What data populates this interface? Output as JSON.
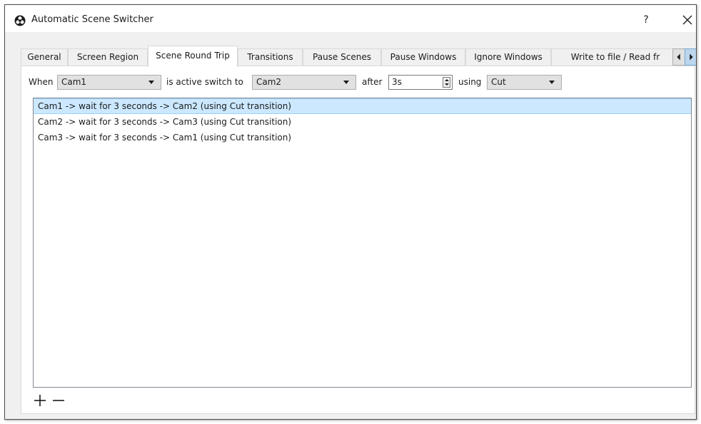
{
  "window": {
    "title": "Automatic Scene Switcher",
    "help_label": "?",
    "close_icon": "close-icon",
    "app_icon": "obs-logo-icon"
  },
  "tabs": [
    {
      "label": "General",
      "active": false
    },
    {
      "label": "Screen Region",
      "active": false
    },
    {
      "label": "Scene Round Trip",
      "active": true
    },
    {
      "label": "Transitions",
      "active": false
    },
    {
      "label": "Pause Scenes",
      "active": false
    },
    {
      "label": "Pause Windows",
      "active": false
    },
    {
      "label": "Ignore Windows",
      "active": false
    },
    {
      "label": "Write to file / Read fr",
      "active": false
    }
  ],
  "controls": {
    "when_label": "When",
    "when_scene": "Cam1",
    "active_label": "is active switch to",
    "target_scene": "Cam2",
    "after_label": "after",
    "delay_value": "3s",
    "using_label": "using",
    "transition": "Cut"
  },
  "list": {
    "items": [
      "Cam1 -> wait for 3 seconds -> Cam2 (using Cut transition)",
      "Cam2 -> wait for 3 seconds -> Cam3 (using Cut transition)",
      "Cam3 -> wait for 3 seconds -> Cam1 (using Cut transition)"
    ],
    "selected_index": 0
  },
  "actions": {
    "add_icon": "plus-icon",
    "remove_icon": "minus-icon"
  },
  "colors": {
    "selection": "#cce8ff",
    "selection_border": "#99d1ff"
  }
}
